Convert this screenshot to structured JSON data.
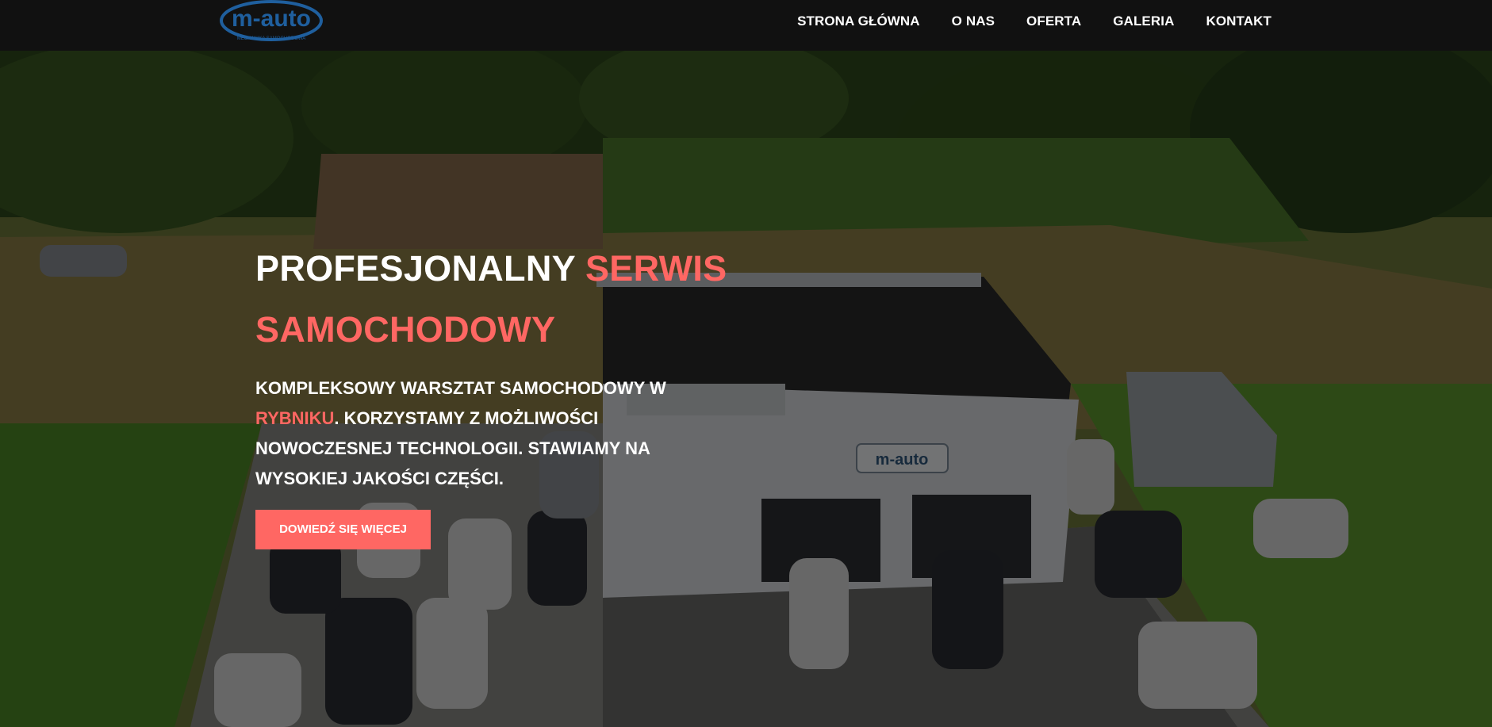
{
  "brand": {
    "logo_text": "m-auto",
    "logo_tagline": "MECHANIKA SAMOCHODOWA",
    "logo_color": "#1f5f9e"
  },
  "nav": {
    "items": [
      {
        "label": "STRONA GŁÓWNA"
      },
      {
        "label": "O NAS"
      },
      {
        "label": "OFERTA"
      },
      {
        "label": "GALERIA"
      },
      {
        "label": "KONTAKT"
      }
    ]
  },
  "hero": {
    "title_part1": "PROFESJONALNY ",
    "title_accent1": "SERWIS",
    "title_accent2": "SAMOCHODOWY",
    "desc_part1": "KOMPLEKSOWY WARSZTAT SAMOCHODOWY W ",
    "desc_accent": "RYBNIKU",
    "desc_part2": ". KORZYSTAMY Z MOŻLIWOŚCI NOWOCZESNEJ TECHNOLOGII. STAWIAMY NA WYSOKIEJ JAKOŚCI CZĘŚCI.",
    "cta_label": "DOWIEDŹ SIĘ WIĘCEJ",
    "building_sign": "m-auto"
  },
  "colors": {
    "accent": "#ff6763",
    "navbar_bg": "#111111",
    "text": "#ffffff"
  }
}
